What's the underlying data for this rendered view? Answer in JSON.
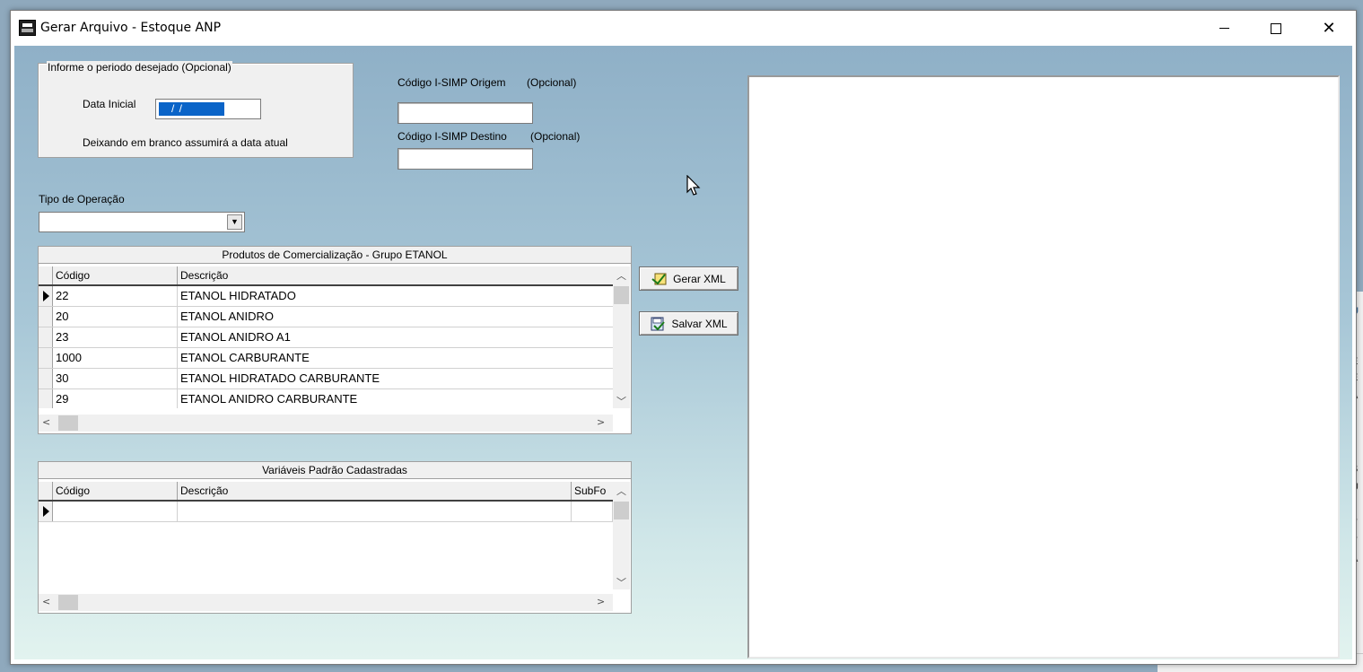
{
  "window": {
    "title": "Gerar Arquivo - Estoque ANP"
  },
  "period": {
    "legend": "Informe o periodo desejado (Opcional)",
    "data_inicial_label": "Data Inicial",
    "data_inicial_value": " / /",
    "hint": "Deixando em branco assumirá a data atual"
  },
  "origem": {
    "label": "Código I-SIMP Origem",
    "optional": "(Opcional)",
    "value": ""
  },
  "destino": {
    "label": "Código I-SIMP Destino",
    "optional": "(Opcional)",
    "value": ""
  },
  "operacao": {
    "label": "Tipo de Operação",
    "selected": ""
  },
  "produtos_grid": {
    "caption": "Produtos de Comercialização - Grupo ETANOL",
    "columns": [
      "Código",
      "Descrição"
    ],
    "rows": [
      {
        "codigo": "22",
        "descricao": "ETANOL HIDRATADO",
        "current": true
      },
      {
        "codigo": "20",
        "descricao": "ETANOL ANIDRO",
        "current": false
      },
      {
        "codigo": "23",
        "descricao": "ETANOL ANIDRO A1",
        "current": false
      },
      {
        "codigo": "1000",
        "descricao": "ETANOL CARBURANTE",
        "current": false
      },
      {
        "codigo": "30",
        "descricao": "ETANOL HIDRATADO CARBURANTE",
        "current": false
      },
      {
        "codigo": "29",
        "descricao": "ETANOL ANIDRO CARBURANTE",
        "current": false
      }
    ]
  },
  "variaveis_grid": {
    "caption": "Variáveis Padrão Cadastradas",
    "columns": [
      "Código",
      "Descrição",
      "SubFo"
    ],
    "rows": [
      {
        "codigo": "",
        "descricao": "",
        "subfo": "",
        "current": true
      }
    ]
  },
  "buttons": {
    "gerar_xml": "Gerar XML",
    "salvar_xml": "Salvar XML"
  },
  "icons": {
    "app": "app-icon",
    "gerar": "gerar-xml-icon",
    "salvar": "salvar-xml-icon"
  },
  "colors": {
    "client_top": "#8fb0c7",
    "client_bottom": "#e2f3ef",
    "selection": "#0a64c8"
  }
}
